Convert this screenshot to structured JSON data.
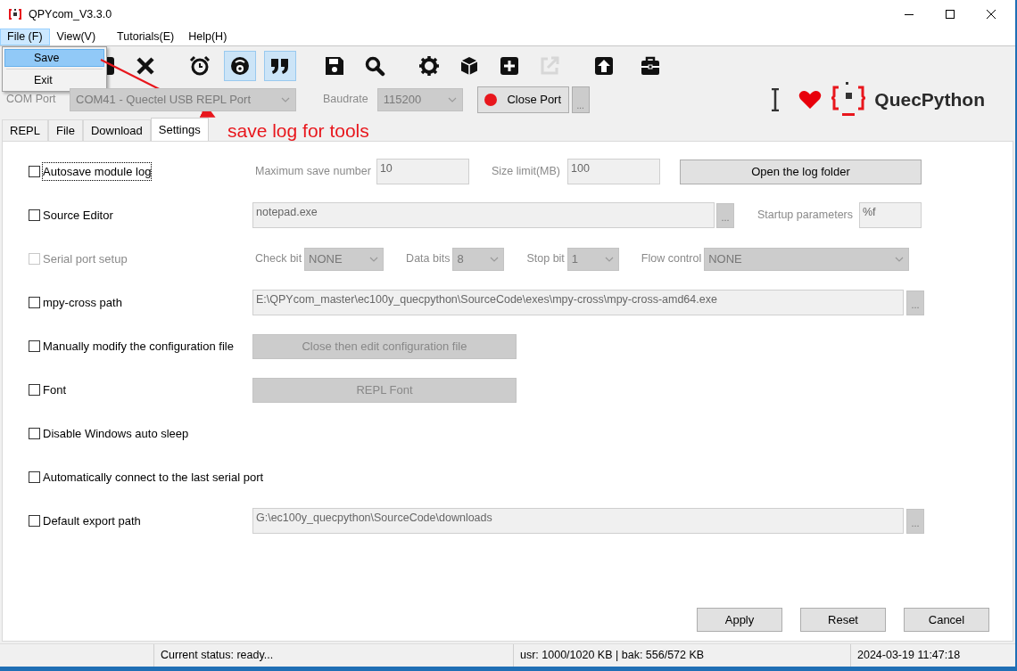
{
  "window": {
    "title": "QPYcom_V3.3.0"
  },
  "menu_bar": [
    {
      "label": "File (F)",
      "selected": true
    },
    {
      "label": "View(V)",
      "selected": false
    },
    {
      "label": "Tutorials(E)",
      "selected": false
    },
    {
      "label": "Help(H)",
      "selected": false
    }
  ],
  "file_menu": [
    {
      "label": "Save",
      "selected": true
    },
    {
      "label": "Exit",
      "selected": false
    }
  ],
  "toolbar": [
    {
      "kind": "square",
      "active": false,
      "disabled": false
    },
    {
      "kind": "close",
      "active": false,
      "disabled": false
    },
    {
      "kind": "alarm",
      "active": false,
      "disabled": false
    },
    {
      "kind": "circle",
      "active": true,
      "disabled": false
    },
    {
      "kind": "quote",
      "active": true,
      "disabled": false
    },
    {
      "kind": "save",
      "active": false,
      "disabled": false
    },
    {
      "kind": "search",
      "active": false,
      "disabled": false
    },
    {
      "kind": "gear",
      "active": false,
      "disabled": false
    },
    {
      "kind": "cube",
      "active": false,
      "disabled": false
    },
    {
      "kind": "plus",
      "active": false,
      "disabled": false
    },
    {
      "kind": "export",
      "active": false,
      "disabled": true
    },
    {
      "kind": "upload",
      "active": false,
      "disabled": false
    },
    {
      "kind": "toolbox",
      "active": false,
      "disabled": false
    }
  ],
  "port_bar": {
    "port_label": "COM Port",
    "port": "COM41 - Quectel USB REPL Port",
    "baud_label": "Baudrate",
    "baud": "115200",
    "connect_button": "Close Port",
    "more_button": "..."
  },
  "brand": "QuecPython",
  "tabs": [
    {
      "label": "REPL",
      "selected": false
    },
    {
      "label": "File",
      "selected": false
    },
    {
      "label": "Download",
      "selected": false
    },
    {
      "label": "Settings",
      "selected": true
    }
  ],
  "annotation": "save log for tools",
  "settings": [
    {
      "label": "Autosave module log",
      "checked": false,
      "disabled": false,
      "focused": true,
      "controls": [
        {
          "kind": "label",
          "text": "Maximum save number"
        },
        {
          "kind": "input",
          "value": "10"
        },
        {
          "kind": "label",
          "text": "Size limit(MB)"
        },
        {
          "kind": "input",
          "value": "100"
        },
        {
          "kind": "button",
          "text": "Open the log folder",
          "disabled": false
        }
      ]
    },
    {
      "label": "Source Editor",
      "checked": false,
      "disabled": false,
      "focused": false,
      "controls": [
        {
          "kind": "input",
          "value": "notepad.exe"
        },
        {
          "kind": "browse",
          "text": "..."
        },
        {
          "kind": "label",
          "text": "Startup parameters"
        },
        {
          "kind": "input",
          "value": "%f"
        }
      ]
    },
    {
      "label": "Serial port setup",
      "checked": false,
      "disabled": true,
      "focused": false,
      "controls": [
        {
          "kind": "label",
          "text": "Check bit"
        },
        {
          "kind": "select",
          "value": "NONE"
        },
        {
          "kind": "label",
          "text": "Data bits"
        },
        {
          "kind": "select",
          "value": "8"
        },
        {
          "kind": "label",
          "text": "Stop bit"
        },
        {
          "kind": "select",
          "value": "1"
        },
        {
          "kind": "label",
          "text": "Flow control"
        },
        {
          "kind": "select",
          "value": "NONE"
        }
      ]
    },
    {
      "label": "mpy-cross path",
      "checked": false,
      "disabled": false,
      "focused": false,
      "controls": [
        {
          "kind": "input",
          "value": "E:\\QPYcom_master\\ec100y_quecpython\\SourceCode\\exes\\mpy-cross\\mpy-cross-amd64.exe"
        },
        {
          "kind": "browse",
          "text": "..."
        }
      ]
    },
    {
      "label": "Manually modify the configuration file",
      "checked": false,
      "disabled": false,
      "focused": false,
      "controls": [
        {
          "kind": "button",
          "text": "Close then edit configuration file",
          "disabled": true
        }
      ]
    },
    {
      "label": "Font",
      "checked": false,
      "disabled": false,
      "focused": false,
      "controls": [
        {
          "kind": "button",
          "text": "REPL Font",
          "disabled": true
        }
      ]
    },
    {
      "label": "Disable Windows auto sleep",
      "checked": false,
      "disabled": false,
      "focused": false
    },
    {
      "label": "Automatically connect to the last serial port",
      "checked": false,
      "disabled": false,
      "focused": false
    },
    {
      "label": "Default export path",
      "checked": false,
      "disabled": false,
      "focused": false,
      "controls": [
        {
          "kind": "input",
          "value": "G:\\ec100y_quecpython\\SourceCode\\downloads"
        },
        {
          "kind": "browse",
          "text": "..."
        }
      ]
    }
  ],
  "actions": [
    "Apply",
    "Reset",
    "Cancel"
  ],
  "status_bar": [
    "Current status: ready...",
    "usr: 1000/1020 KB | bak: 556/572 KB",
    "2024-03-19 11:47:18"
  ]
}
